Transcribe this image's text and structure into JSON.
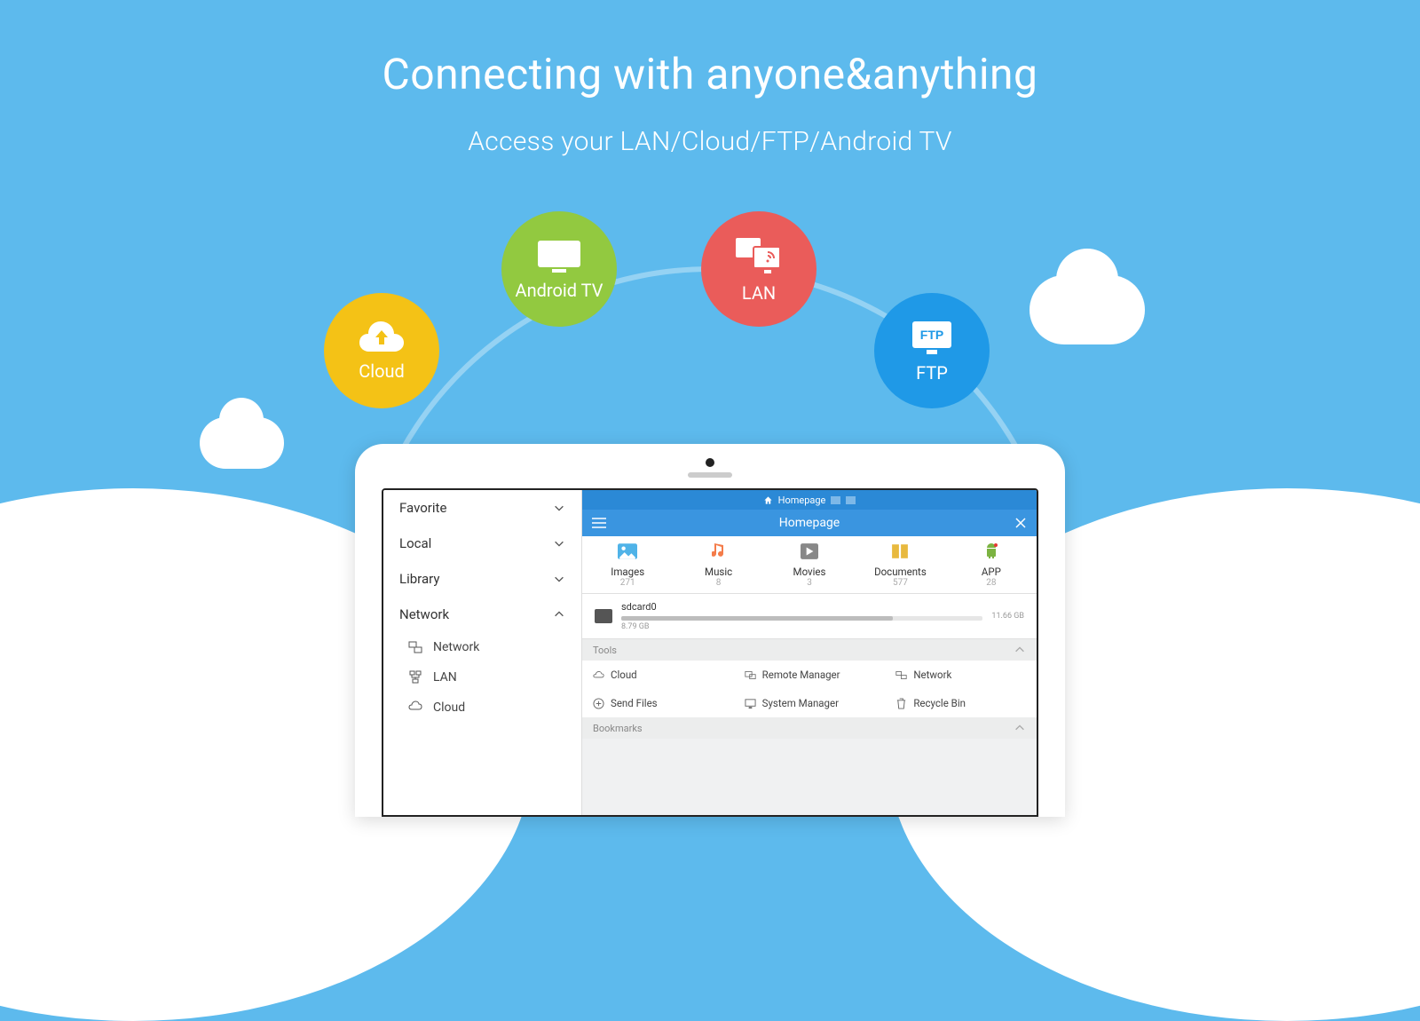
{
  "hero": {
    "title": "Connecting with anyone&anything",
    "subtitle": "Access your LAN/Cloud/FTP/Android TV"
  },
  "bubbles": {
    "cloud": "Cloud",
    "tv": "Android TV",
    "lan": "LAN",
    "ftp": "FTP"
  },
  "sidebar": {
    "items": [
      {
        "label": "Favorite",
        "expanded": false
      },
      {
        "label": "Local",
        "expanded": false
      },
      {
        "label": "Library",
        "expanded": false
      },
      {
        "label": "Network",
        "expanded": true
      }
    ],
    "subs": [
      {
        "label": "Network"
      },
      {
        "label": "LAN"
      },
      {
        "label": "Cloud"
      }
    ]
  },
  "topbar": {
    "tab": "Homepage"
  },
  "titlebar": {
    "title": "Homepage"
  },
  "categories": [
    {
      "label": "Images",
      "count": "271"
    },
    {
      "label": "Music",
      "count": "8"
    },
    {
      "label": "Movies",
      "count": "3"
    },
    {
      "label": "Documents",
      "count": "577"
    },
    {
      "label": "APP",
      "count": "28"
    }
  ],
  "storage": {
    "name": "sdcard0",
    "used": "8.79 GB",
    "total": "11.66 GB",
    "percent": 75
  },
  "sections": {
    "tools": "Tools",
    "bookmarks": "Bookmarks"
  },
  "tools": [
    {
      "label": "Cloud"
    },
    {
      "label": "Remote Manager"
    },
    {
      "label": "Network"
    },
    {
      "label": "Send Files"
    },
    {
      "label": "System Manager"
    },
    {
      "label": "Recycle Bin"
    }
  ]
}
